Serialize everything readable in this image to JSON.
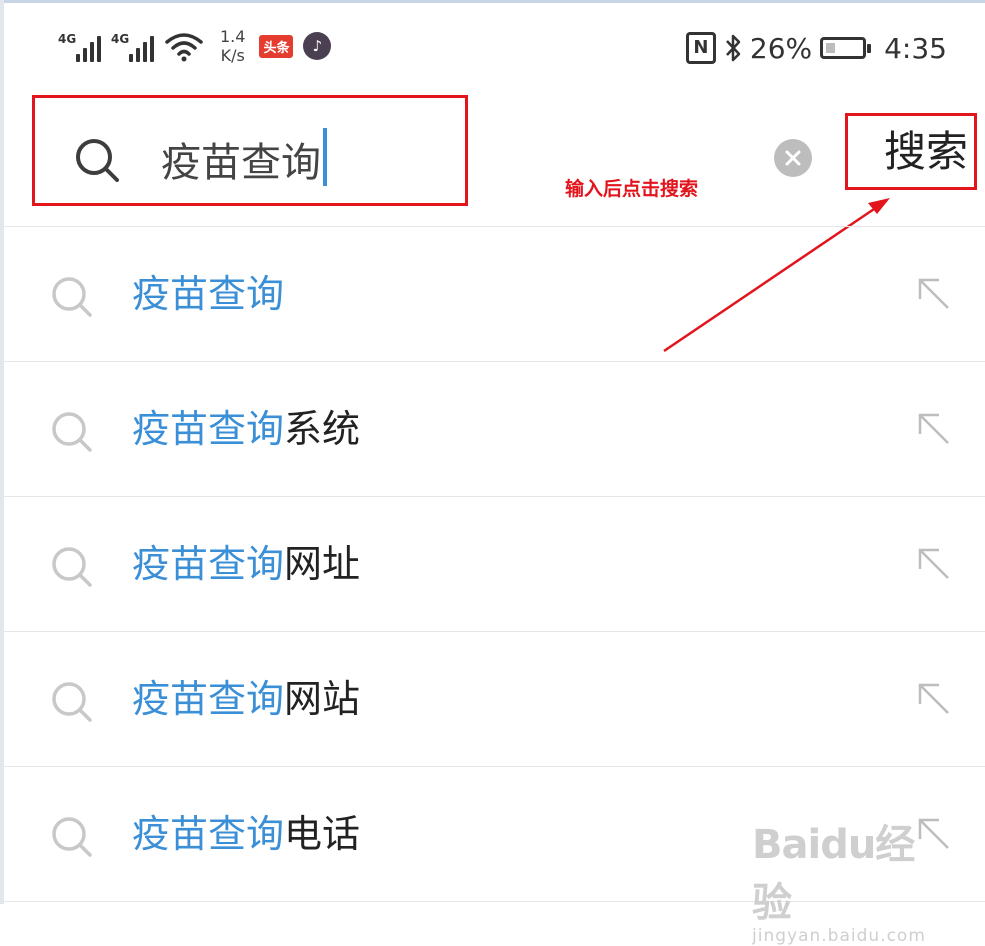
{
  "status_bar": {
    "network_1": "4G",
    "network_2": "4G",
    "speed_value": "1.4",
    "speed_unit": "K/s",
    "app_badge": "头条",
    "battery_text": "26%",
    "battery_level_percent": 26,
    "clock": "4:35",
    "icons": [
      "signal-icon",
      "wifi-icon",
      "tiktok-icon",
      "nfc-icon",
      "bluetooth-icon",
      "battery-icon"
    ]
  },
  "search": {
    "query": "疫苗查询",
    "button_label": "搜索"
  },
  "annotation": {
    "text": "输入后点击搜索",
    "color": "#e2141c"
  },
  "suggestions": [
    {
      "highlight": "疫苗查询",
      "rest": ""
    },
    {
      "highlight": "疫苗查询",
      "rest": "系统"
    },
    {
      "highlight": "疫苗查询",
      "rest": "网址"
    },
    {
      "highlight": "疫苗查询",
      "rest": "网站"
    },
    {
      "highlight": "疫苗查询",
      "rest": "电话"
    }
  ],
  "watermark": {
    "logo": "Baidu经验",
    "url": "jingyan.baidu.com"
  },
  "colors": {
    "highlight": "#3b8fd6",
    "annotation_red": "#e2141c",
    "caret": "#3c8ed8"
  }
}
